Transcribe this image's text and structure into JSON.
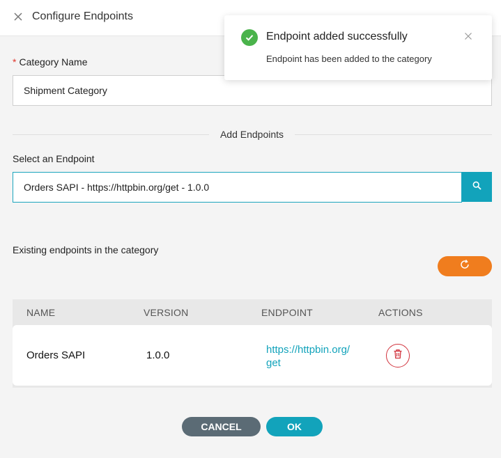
{
  "header": {
    "title": "Configure Endpoints",
    "close_icon": "close-icon"
  },
  "form": {
    "required_mark": "*",
    "category_label": "Category Name",
    "category_value": "Shipment Category",
    "section_title": "Add Endpoints",
    "endpoint_label": "Select an Endpoint",
    "endpoint_value": "Orders SAPI - https://httpbin.org/get - 1.0.0",
    "search_icon": "search-icon"
  },
  "existing": {
    "title": "Existing endpoints in the category",
    "refresh_icon": "refresh-icon",
    "columns": [
      "Name",
      "Version",
      "Endpoint",
      "Actions"
    ],
    "rows": [
      {
        "name": "Orders SAPI",
        "version": "1.0.0",
        "endpoint_line1": "https://httpbin.org/",
        "endpoint_line2": "get",
        "action_icon": "trash-icon"
      }
    ]
  },
  "footer": {
    "cancel_label": "Cancel",
    "ok_label": "OK"
  },
  "toast": {
    "title": "Endpoint added successfully",
    "message": "Endpoint has been added to the category",
    "icon": "check-circle-icon",
    "close_icon": "close-icon"
  },
  "colors": {
    "accent": "#12a3bb",
    "refresh": "#f07d1e",
    "cancel": "#5b6b75",
    "danger": "#d1323c",
    "success": "#4ab34b",
    "required": "#e0362c"
  }
}
